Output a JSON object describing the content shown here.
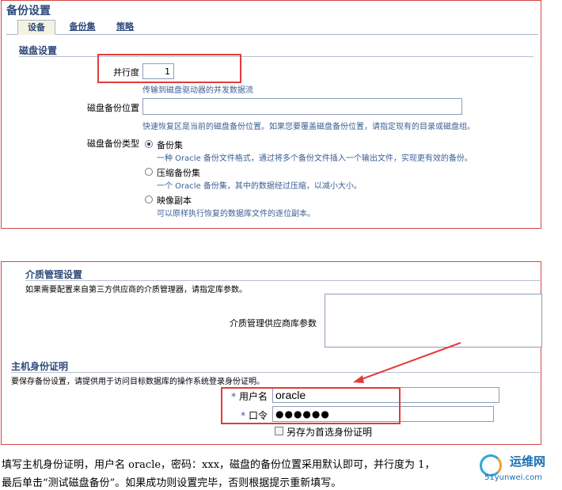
{
  "backup": {
    "title": "备份设置",
    "tabs": [
      {
        "label": "设备"
      },
      {
        "label": "备份集"
      },
      {
        "label": "策略"
      }
    ],
    "disk_settings": {
      "header": "磁盘设置",
      "parallelism_label": "并行度",
      "parallelism_value": "1",
      "parallelism_hint": "传输到磁盘驱动器的并发数据流",
      "location_label": "磁盘备份位置",
      "location_value": "",
      "location_hint": "快速恢复区是当前的磁盘备份位置。如果您要覆盖磁盘备份位置，请指定现有的目录或磁盘组。",
      "type_label": "磁盘备份类型",
      "types": [
        {
          "label": "备份集",
          "desc": "一种 Oracle 备份文件格式，通过将多个备份文件插入一个输出文件，实现更有效的备份。",
          "checked": true
        },
        {
          "label": "压缩备份集",
          "desc": "一个 Oracle 备份集，其中的数据经过压缩，以减小大小。",
          "checked": false
        },
        {
          "label": "映像副本",
          "desc": "可以原样执行恢复的数据库文件的逐位副本。",
          "checked": false
        }
      ]
    }
  },
  "media": {
    "header": "介质管理设置",
    "desc": "如果需要配置来自第三方供应商的介质管理器，请指定库参数。",
    "params_label": "介质管理供应商库参数",
    "params_value": ""
  },
  "host": {
    "header": "主机身份证明",
    "desc": "要保存备份设置，请提供用于访问目标数据库的操作系统登录身份证明。",
    "username_label": "用户名",
    "username_value": "oracle",
    "password_label": "口令",
    "password_value": "●●●●●●",
    "save_label": "另存为首选身份证明",
    "required_mark": "*"
  },
  "instructions": {
    "line1": "填写主机身份证明，用户名 oracle，密码：xxx，磁盘的备份位置采用默认即可，并行度为 1，",
    "line2": "最后单击“测试磁盘备份”。如果成功则设置完毕，否则根据提示重新填写。"
  },
  "watermark": {
    "text1": "运维网",
    "text2": "51yunwei.com"
  },
  "colors": {
    "annotation_red": "#e33b3b",
    "header_blue": "#2f4a7a",
    "hint_blue": "#3b5e93"
  }
}
